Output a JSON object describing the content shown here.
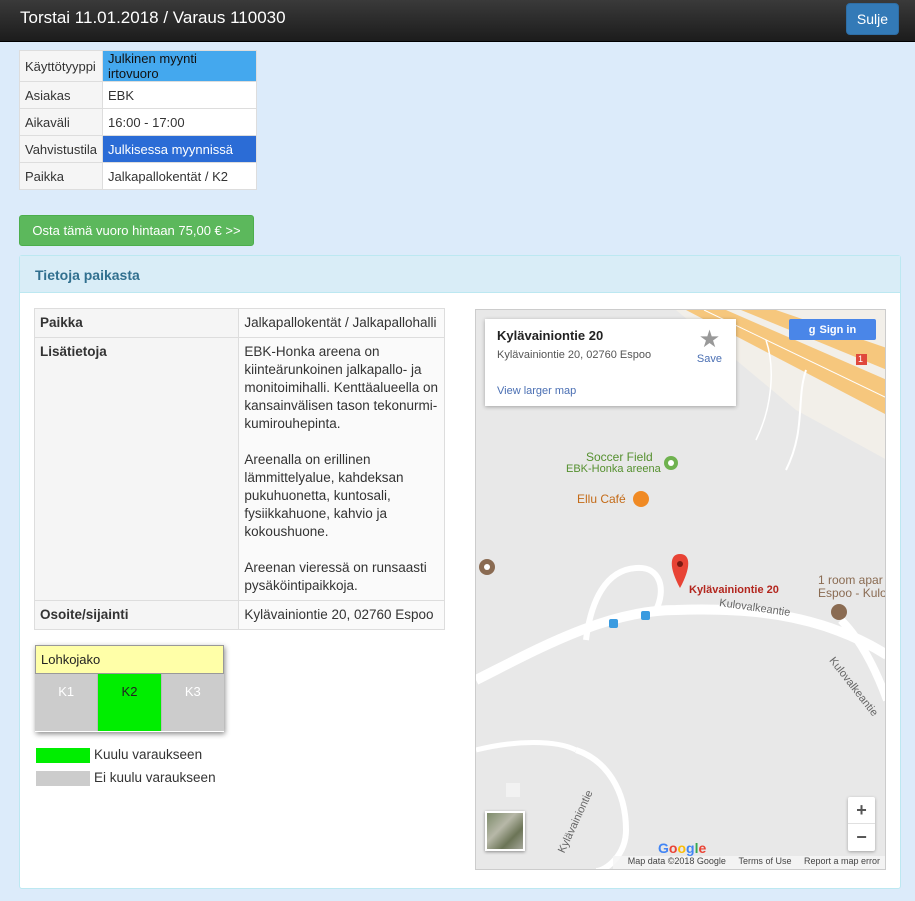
{
  "header": {
    "title": "Torstai 11.01.2018 / Varaus 110030",
    "close_label": "Sulje"
  },
  "booking_info": {
    "rows": [
      {
        "label": "Käyttötyyppi",
        "value": "Julkinen myynti irtovuoro",
        "highlight": "#44a8ee"
      },
      {
        "label": "Asiakas",
        "value": "EBK"
      },
      {
        "label": "Aikaväli",
        "value": "16:00 - 17:00"
      },
      {
        "label": "Vahvistustila",
        "value": "Julkisessa myynnissä",
        "highlight": "#2b6cd6"
      },
      {
        "label": "Paikka",
        "value": "Jalkapallokentät / K2"
      }
    ]
  },
  "buy_button_label": "Osta tämä vuoro hintaan 75,00 € >>",
  "venue_panel": {
    "heading": "Tietoja paikasta",
    "place_label": "Paikka",
    "place_value": "Jalkapallokentät / Jalkapallohalli",
    "details_label": "Lisätietoja",
    "details_paragraphs": [
      "EBK-Honka areena on kiinteärunkoinen jalkapallo- ja monitoimihalli. Kenttäalueella on kansainvälisen tason tekonurmi-kumirouhepinta.",
      "Areenalla on erillinen lämmittelyalue, kahdeksan pukuhuonetta, kuntosali, fysiikkahuone, kahvio ja kokoushuone.",
      "Areenan vieressä on runsaasti pysäköintipaikkoja."
    ],
    "address_label": "Osoite/sijainti",
    "address_value": "Kylävainiontie 20, 02760 Espoo"
  },
  "blocks": {
    "title": "Lohkojako",
    "items": [
      {
        "label": "K1",
        "included": false
      },
      {
        "label": "K2",
        "included": true
      },
      {
        "label": "K3",
        "included": false
      }
    ]
  },
  "legend": {
    "included_label": "Kuulu varaukseen",
    "excluded_label": "Ei kuulu varaukseen",
    "included_color": "#00ee00",
    "excluded_color": "#cccccc"
  },
  "map": {
    "card_title": "Kylävainiontie 20",
    "card_address": "Kylävainiontie 20, 02760 Espoo",
    "view_larger": "View larger map",
    "save_label": "Save",
    "sign_in": "Sign in",
    "poi_soccer": "Soccer Field",
    "poi_soccer_sub": "EBK-Honka areena",
    "poi_cafe": "Ellu Café",
    "pin_label": "Kylävainiontie 20",
    "street_1": "Kulovalkeantie",
    "street_2": "Kulovalkeantie",
    "street_3": "Kylävainiontie",
    "poi_apartment_1": "1 room apar",
    "poi_apartment_2": "Espoo - Kulo",
    "road_badge": "1",
    "google": "Google",
    "attrib_data": "Map data ©2018 Google",
    "attrib_terms": "Terms of Use",
    "attrib_report": "Report a map error",
    "zoom_in": "+",
    "zoom_out": "−"
  }
}
